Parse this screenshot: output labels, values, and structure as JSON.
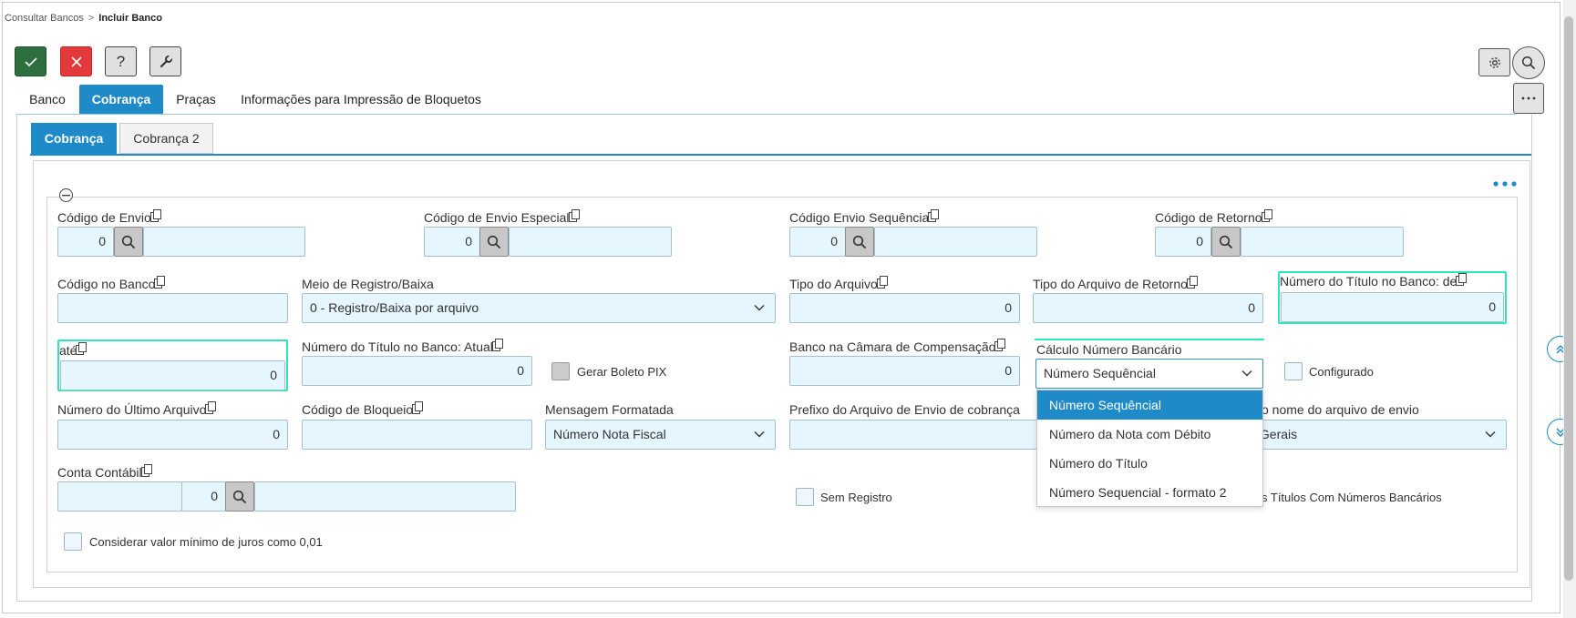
{
  "breadcrumb": {
    "parent": "Consultar Bancos",
    "separator": ">",
    "current": "Incluir Banco"
  },
  "toolbar": {
    "help_label": "?"
  },
  "main_tabs": [
    "Banco",
    "Cobrança",
    "Praças",
    "Informações para Impressão de Bloquetos"
  ],
  "sub_tabs": [
    "Cobrança",
    "Cobrança 2"
  ],
  "fields": {
    "codigo_envio": {
      "label": "Código de Envio",
      "value": "0"
    },
    "codigo_envio_especial": {
      "label": "Código de Envio Especial",
      "value": "0"
    },
    "codigo_envio_sequencia": {
      "label": "Código Envio Sequência",
      "value": "0"
    },
    "codigo_retorno": {
      "label": "Código de Retorno",
      "value": "0"
    },
    "codigo_banco": {
      "label": "Código no Banco",
      "value": ""
    },
    "meio_registro": {
      "label": "Meio de Registro/Baixa",
      "value": "0 - Registro/Baixa por arquivo"
    },
    "tipo_arquivo": {
      "label": "Tipo do Arquivo",
      "value": "0"
    },
    "tipo_arquivo_retorno": {
      "label": "Tipo do Arquivo de Retorno",
      "value": "0"
    },
    "numero_titulo_de": {
      "label": "Número do Título no Banco: de",
      "value": "0"
    },
    "ate": {
      "label": "até",
      "value": "0"
    },
    "numero_titulo_atual": {
      "label": "Número do Título no Banco: Atual",
      "value": "0"
    },
    "gerar_boleto_pix": {
      "label": "Gerar Boleto PIX"
    },
    "banco_camara": {
      "label": "Banco na Câmara de Compensação",
      "value": "0"
    },
    "calculo_numero": {
      "label": "Cálculo Número Bancário",
      "value": "Número Sequêncial"
    },
    "configurado": {
      "label": "Configurado"
    },
    "numero_ultimo_arquivo": {
      "label": "Número do Último Arquivo",
      "value": "0"
    },
    "codigo_bloqueio": {
      "label": "Código de Bloqueio",
      "value": ""
    },
    "mensagem_formatada": {
      "label": "Mensagem Formatada",
      "value": "Número Nota Fiscal"
    },
    "prefixo_arquivo": {
      "label": "Prefixo do Arquivo de Envio de cobrança",
      "value": ""
    },
    "nome_arquivo_envio": {
      "label": "o nome do arquivo de envio",
      "value": "s Gerais"
    },
    "conta_contabil": {
      "label": "Conta Contábil",
      "value": "0"
    },
    "sem_registro": {
      "label": "Sem Registro"
    },
    "titulos_numeros": {
      "label": "s Títulos Com Números Bancários"
    },
    "considerar_juros": {
      "label": "Considerar valor mínimo de juros como 0,01"
    }
  },
  "dropdown_options": [
    "Número Sequêncial",
    "Número da Nota com Débito",
    "Número do Título",
    "Número Sequencial - formato 2"
  ],
  "colors": {
    "accent": "#1e8bc8",
    "confirm": "#2e6f3f",
    "cancel": "#e3393c",
    "field_bg": "#e6f6ff",
    "highlight": "#2fe3bb"
  }
}
